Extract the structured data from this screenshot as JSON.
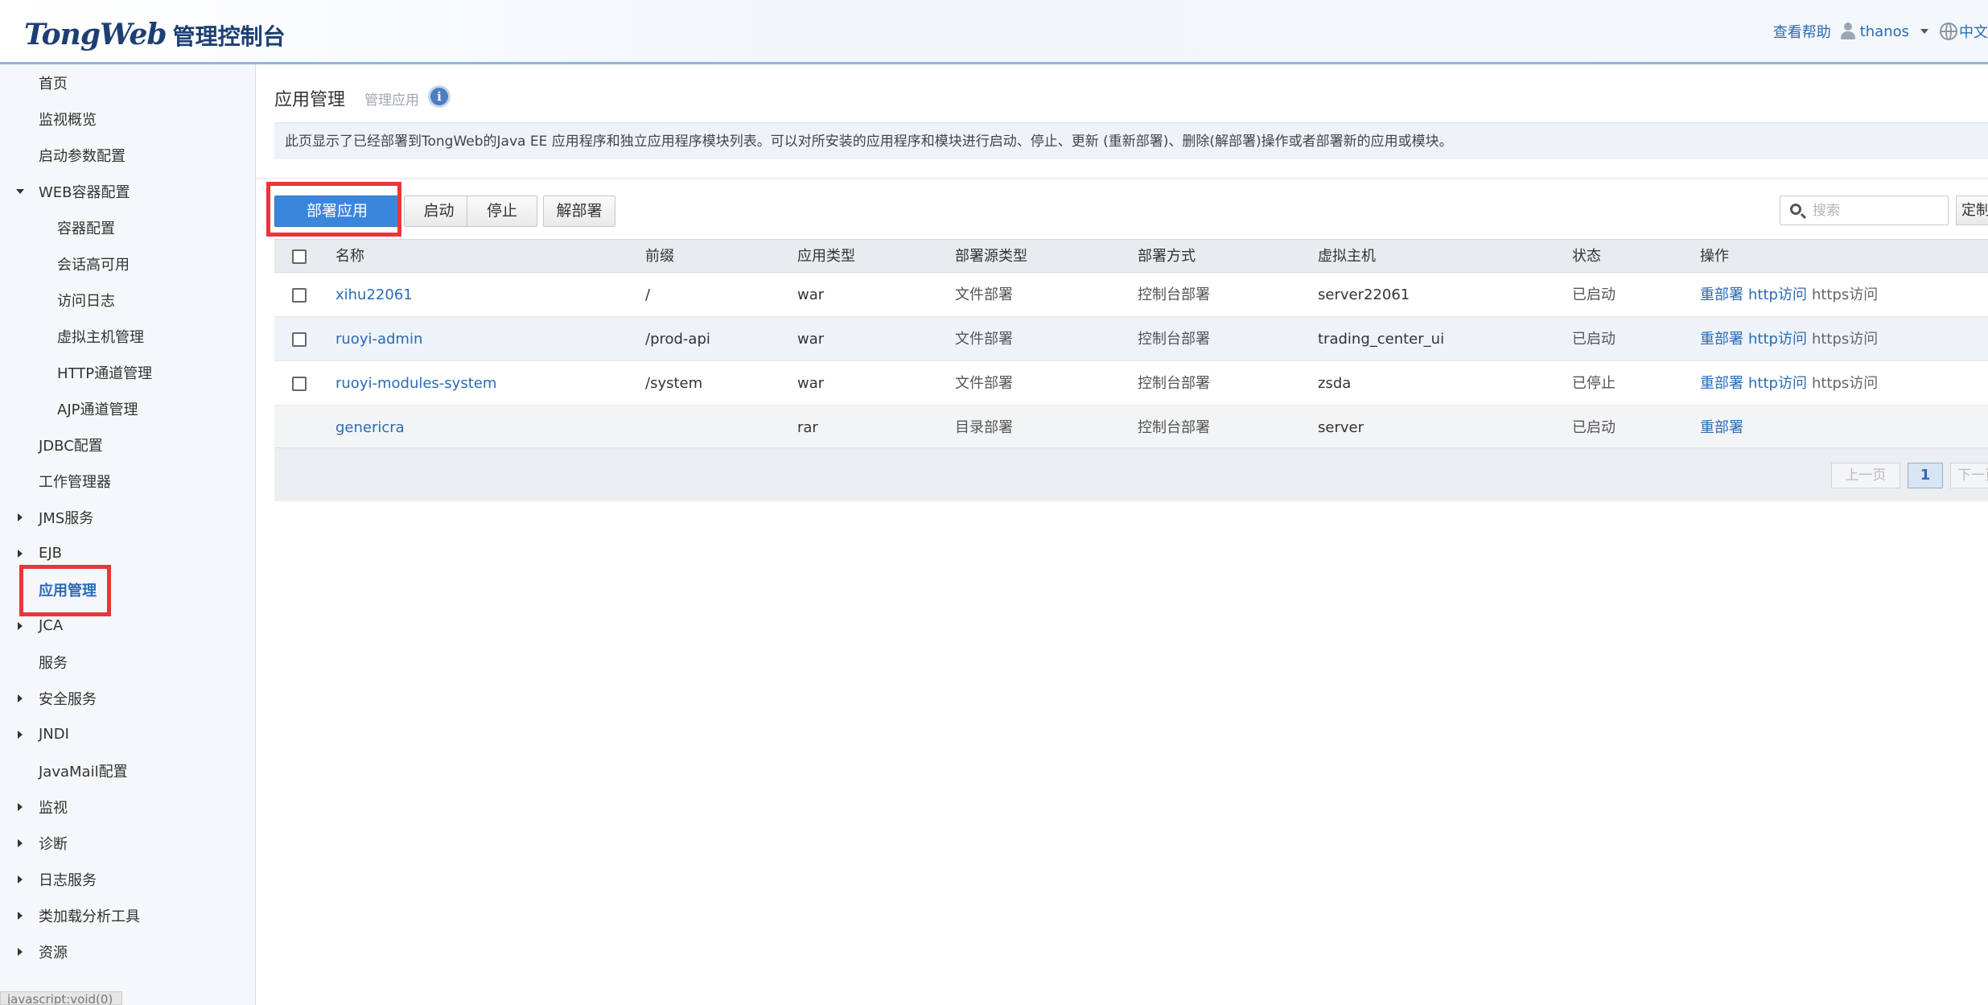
{
  "header": {
    "logo_tong": "Tong",
    "logo_web": "Web",
    "logo_cn": "管理控制台",
    "help": "查看帮助",
    "user": "thanos",
    "lang": "中文"
  },
  "sidebar": {
    "items": [
      {
        "label": "首页"
      },
      {
        "label": "监视概览"
      },
      {
        "label": "启动参数配置"
      },
      {
        "label": "WEB容器配置"
      },
      {
        "label": "容器配置"
      },
      {
        "label": "会话高可用"
      },
      {
        "label": "访问日志"
      },
      {
        "label": "虚拟主机管理"
      },
      {
        "label": "HTTP通道管理"
      },
      {
        "label": "AJP通道管理"
      },
      {
        "label": "JDBC配置"
      },
      {
        "label": "工作管理器"
      },
      {
        "label": "JMS服务"
      },
      {
        "label": "EJB"
      },
      {
        "label": "应用管理"
      },
      {
        "label": "JCA"
      },
      {
        "label": "服务"
      },
      {
        "label": "安全服务"
      },
      {
        "label": "JNDI"
      },
      {
        "label": "JavaMail配置"
      },
      {
        "label": "监视"
      },
      {
        "label": "诊断"
      },
      {
        "label": "日志服务"
      },
      {
        "label": "类加载分析工具"
      },
      {
        "label": "资源"
      }
    ],
    "status_url": "javascript:void(0)"
  },
  "main": {
    "title": "应用管理",
    "subtitle": "管理应用",
    "info_glyph": "i",
    "description": "此页显示了已经部署到TongWeb的Java EE 应用程序和独立应用程序模块列表。可以对所安装的应用程序和模块进行启动、停止、更新 (重新部署)、删除(解部署)操作或者部署新的应用或模块。",
    "toolbar": {
      "deploy": "部署应用",
      "start": "启动",
      "stop": "停止",
      "undeploy": "解部署",
      "search_placeholder": "搜索",
      "custom": "定制"
    },
    "table": {
      "headers": {
        "name": "名称",
        "prefix": "前缀",
        "app_type": "应用类型",
        "source_type": "部署源类型",
        "deploy_mode": "部署方式",
        "vhost": "虚拟主机",
        "status": "状态",
        "ops": "操作"
      },
      "rows": [
        {
          "name": "xihu22061",
          "prefix": "/",
          "app_type": "war",
          "source_type": "文件部署",
          "deploy_mode": "控制台部署",
          "vhost": "server22061",
          "status": "已启动",
          "op1": "重部署",
          "op2": "http访问",
          "op3": "https访问"
        },
        {
          "name": "ruoyi-admin",
          "prefix": "/prod-api",
          "app_type": "war",
          "source_type": "文件部署",
          "deploy_mode": "控制台部署",
          "vhost": "trading_center_ui",
          "status": "已启动",
          "op1": "重部署",
          "op2": "http访问",
          "op3": "https访问"
        },
        {
          "name": "ruoyi-modules-system",
          "prefix": "/system",
          "app_type": "war",
          "source_type": "文件部署",
          "deploy_mode": "控制台部署",
          "vhost": "zsda",
          "status": "已停止",
          "op1": "重部署",
          "op2": "http访问",
          "op3": "https访问"
        },
        {
          "name": "genericra",
          "prefix": "",
          "app_type": "rar",
          "source_type": "目录部署",
          "deploy_mode": "控制台部署",
          "vhost": "server",
          "status": "已启动",
          "op1": "重部署",
          "op2": "",
          "op3": ""
        }
      ]
    },
    "pagination": {
      "prev": "上一页",
      "current": "1",
      "next": "下一页"
    }
  },
  "colors": {
    "accent": "#3b86dd",
    "link": "#2a6bb5",
    "highlight": "#e8363a"
  }
}
